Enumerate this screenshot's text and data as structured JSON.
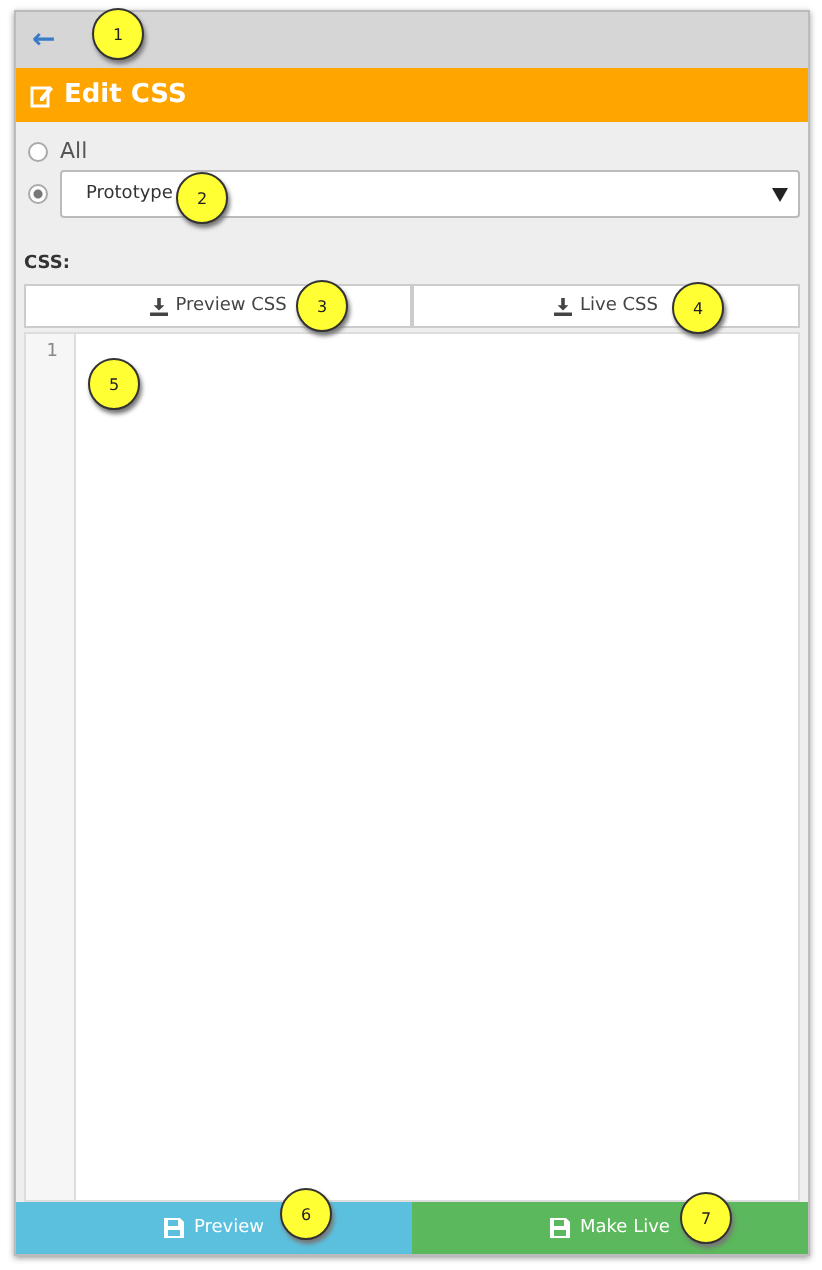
{
  "header": {
    "back": "←"
  },
  "title": "Edit CSS",
  "scope": {
    "options": [
      {
        "label": "All",
        "selected": false,
        "kind": "text"
      },
      {
        "label": "Prototype",
        "selected": true,
        "kind": "select"
      }
    ]
  },
  "css_label": "CSS:",
  "download_buttons": [
    "Preview CSS",
    "Live CSS"
  ],
  "editor": {
    "line_numbers": [
      "1"
    ]
  },
  "actions": [
    {
      "label": "Preview",
      "kind": "info"
    },
    {
      "label": "Make Live",
      "kind": "success"
    }
  ],
  "callouts": [
    "1",
    "2",
    "3",
    "4",
    "5",
    "6",
    "7"
  ]
}
